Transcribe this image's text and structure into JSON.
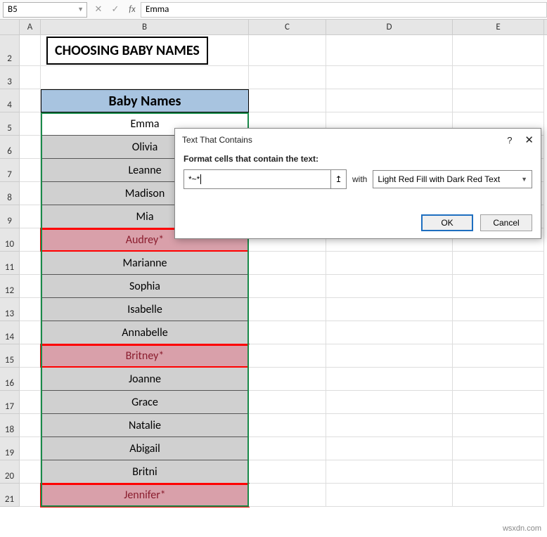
{
  "formula_bar": {
    "cell_ref": "B5",
    "formula": "Emma"
  },
  "column_headers": [
    "A",
    "B",
    "C",
    "D",
    "E"
  ],
  "row_headers": [
    "2",
    "3",
    "4",
    "5",
    "6",
    "7",
    "8",
    "9",
    "10",
    "11",
    "12",
    "13",
    "14",
    "15",
    "16",
    "17",
    "18",
    "19",
    "20",
    "21"
  ],
  "title": "CHOOSING BABY NAMES",
  "table_header": "Baby Names",
  "names": [
    {
      "value": "Emma",
      "match": false,
      "selected": true
    },
    {
      "value": "Olivia",
      "match": false
    },
    {
      "value": "Leanne",
      "match": false
    },
    {
      "value": "Madison",
      "match": false
    },
    {
      "value": "Mia",
      "match": false
    },
    {
      "value": "Audrey*",
      "match": true
    },
    {
      "value": "Marianne",
      "match": false
    },
    {
      "value": "Sophia",
      "match": false
    },
    {
      "value": "Isabelle",
      "match": false
    },
    {
      "value": "Annabelle",
      "match": false
    },
    {
      "value": "Britney*",
      "match": true
    },
    {
      "value": "Joanne",
      "match": false
    },
    {
      "value": "Grace",
      "match": false
    },
    {
      "value": "Natalie",
      "match": false
    },
    {
      "value": "Abigail",
      "match": false
    },
    {
      "value": "Britni",
      "match": false
    },
    {
      "value": "Jennifer*",
      "match": true
    }
  ],
  "dialog": {
    "title": "Text That Contains",
    "label": "Format cells that contain the text:",
    "input_value": "*~*",
    "with_label": "with",
    "format_option": "Light Red Fill with Dark Red Text",
    "ok": "OK",
    "cancel": "Cancel",
    "help": "?",
    "close": "✕"
  },
  "watermark": "wsxdn.com"
}
